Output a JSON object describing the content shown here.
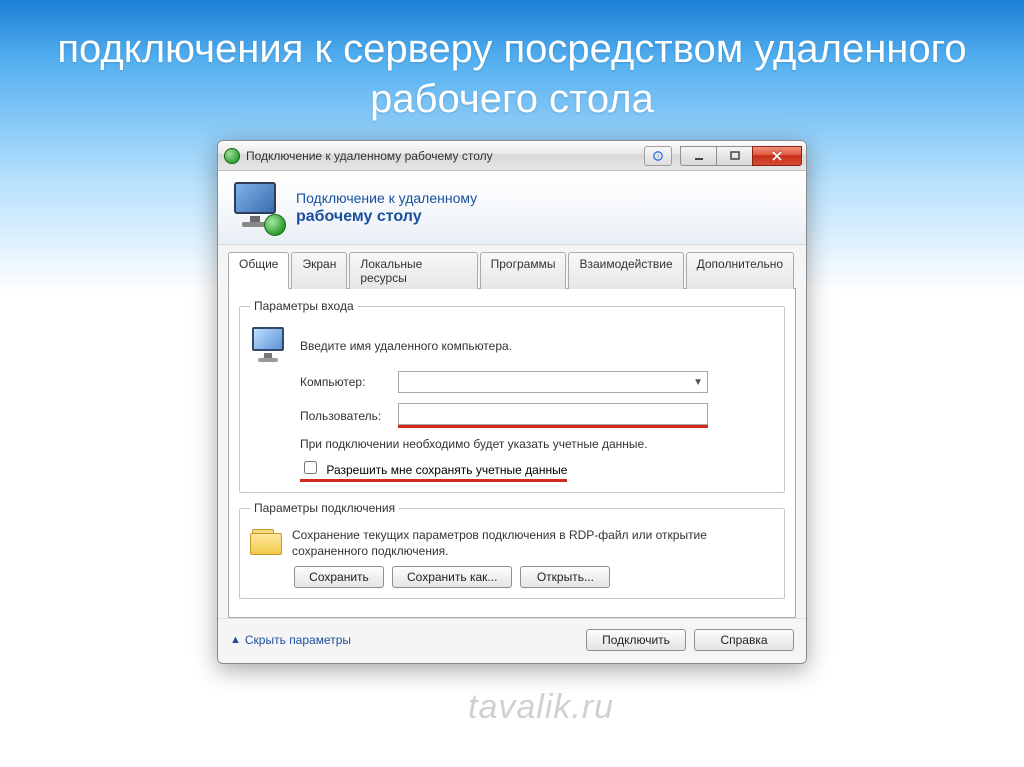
{
  "slide": {
    "title": "подключения к серверу посредством удаленного рабочего стола"
  },
  "window": {
    "title": "Подключение к удаленному рабочему столу",
    "banner": {
      "line1": "Подключение к удаленному",
      "line2": "рабочему столу"
    },
    "tabs": [
      "Общие",
      "Экран",
      "Локальные ресурсы",
      "Программы",
      "Взаимодействие",
      "Дополнительно"
    ],
    "active_tab": 0,
    "login": {
      "legend": "Параметры входа",
      "prompt": "Введите имя удаленного компьютера.",
      "computer_label": "Компьютер:",
      "computer_value": "",
      "user_label": "Пользователь:",
      "user_value": "",
      "note": "При подключении необходимо будет указать учетные данные.",
      "save_creds_label": "Разрешить мне сохранять учетные данные",
      "save_creds_checked": false
    },
    "connection": {
      "legend": "Параметры подключения",
      "desc": "Сохранение текущих параметров подключения в RDP-файл или открытие сохраненного подключения.",
      "save": "Сохранить",
      "save_as": "Сохранить как...",
      "open": "Открыть..."
    },
    "footer": {
      "hide": "Скрыть параметры",
      "connect": "Подключить",
      "help": "Справка"
    }
  },
  "watermark": "tavalik.ru"
}
